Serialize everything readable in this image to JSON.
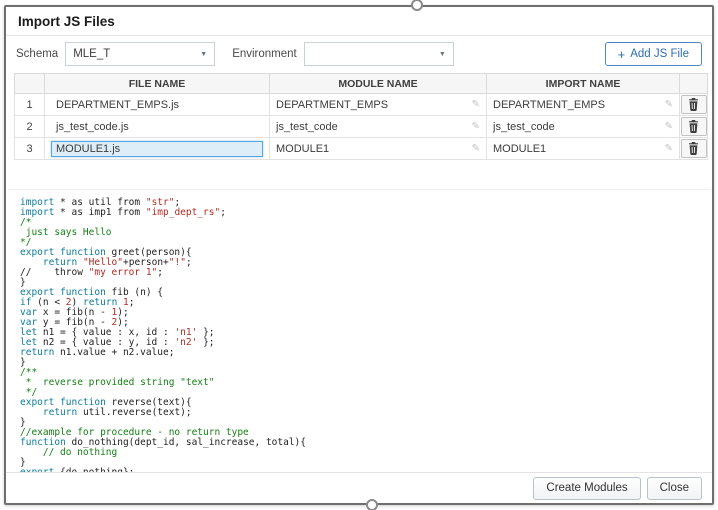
{
  "dialog": {
    "title": "Import JS Files"
  },
  "icons": {
    "caret": "▼",
    "pencil": "✎",
    "plus": "+",
    "trash": "trash-icon"
  },
  "colors": {
    "accent_blue": "#2d6db3",
    "selection_bg": "#ddeef9",
    "selection_border": "#58a6dd"
  },
  "toolbar": {
    "schema_label": "Schema",
    "schema_value": "MLE_T",
    "environment_label": "Environment",
    "environment_value": "",
    "add_button_label": "Add JS File"
  },
  "grid": {
    "headers": [
      "FILE NAME",
      "MODULE NAME",
      "IMPORT NAME"
    ],
    "rows": [
      {
        "num": "1",
        "file": "DEPARTMENT_EMPS.js",
        "module": "DEPARTMENT_EMPS",
        "import_name": "DEPARTMENT_EMPS",
        "selected": false
      },
      {
        "num": "2",
        "file": "js_test_code.js",
        "module": "js_test_code",
        "import_name": "js_test_code",
        "selected": false
      },
      {
        "num": "3",
        "file": "MODULE1.js",
        "module": "MODULE1",
        "import_name": "MODULE1",
        "selected": true
      }
    ]
  },
  "editor": {
    "colors": {
      "k": "#0f7b9c",
      "p": "#1f1f1f",
      "s": "#b22a22",
      "c": "#158015",
      "n": "#b22a22"
    },
    "lines": [
      [
        [
          "k",
          "import"
        ],
        [
          "p",
          " * as util from "
        ],
        [
          "s",
          "\"str\""
        ],
        [
          "p",
          ";"
        ]
      ],
      [
        [
          "k",
          "import"
        ],
        [
          "p",
          " * as imp1 from "
        ],
        [
          "s",
          "\"imp_dept_rs\""
        ],
        [
          "p",
          ";"
        ]
      ],
      [
        [
          "c",
          "/*"
        ]
      ],
      [
        [
          "c",
          " just says Hello"
        ]
      ],
      [
        [
          "c",
          "*/"
        ]
      ],
      [
        [
          "k",
          "export function"
        ],
        [
          "p",
          " greet(person){"
        ]
      ],
      [
        [
          "p",
          "    "
        ],
        [
          "k",
          "return"
        ],
        [
          "p",
          " "
        ],
        [
          "s",
          "\"Hello\""
        ],
        [
          "p",
          "+person+"
        ],
        [
          "s",
          "\"!\""
        ],
        [
          "p",
          ";"
        ]
      ],
      [
        [
          "p",
          "//    throw "
        ],
        [
          "s",
          "\"my error 1\""
        ],
        [
          "p",
          ";"
        ]
      ],
      [
        [
          "p",
          "}"
        ]
      ],
      [
        [
          "k",
          "export function"
        ],
        [
          "p",
          " fib (n) {"
        ]
      ],
      [
        [
          "k",
          "if"
        ],
        [
          "p",
          " (n < "
        ],
        [
          "n",
          "2"
        ],
        [
          "p",
          ") "
        ],
        [
          "k",
          "return"
        ],
        [
          "p",
          " "
        ],
        [
          "n",
          "1"
        ],
        [
          "p",
          ";"
        ]
      ],
      [
        [
          "k",
          "var"
        ],
        [
          "p",
          " x = fib(n - "
        ],
        [
          "n",
          "1"
        ],
        [
          "p",
          ");"
        ]
      ],
      [
        [
          "k",
          "var"
        ],
        [
          "p",
          " y = fib(n - "
        ],
        [
          "n",
          "2"
        ],
        [
          "p",
          ");"
        ]
      ],
      [
        [
          "k",
          "let"
        ],
        [
          "p",
          " n1 = { value : x, id : "
        ],
        [
          "s",
          "'n1'"
        ],
        [
          "p",
          " };"
        ]
      ],
      [
        [
          "k",
          "let"
        ],
        [
          "p",
          " n2 = { value : y, id : "
        ],
        [
          "s",
          "'n2'"
        ],
        [
          "p",
          " };"
        ]
      ],
      [
        [
          "k",
          "return"
        ],
        [
          "p",
          " n1.value + n2.value;"
        ]
      ],
      [
        [
          "p",
          "}"
        ]
      ],
      [
        [
          "c",
          "/**"
        ]
      ],
      [
        [
          "c",
          " *  reverse provided string \"text\""
        ]
      ],
      [
        [
          "c",
          " */"
        ]
      ],
      [
        [
          "k",
          "export function"
        ],
        [
          "p",
          " reverse(text){"
        ]
      ],
      [
        [
          "p",
          "    "
        ],
        [
          "k",
          "return"
        ],
        [
          "p",
          " util.reverse(text);"
        ]
      ],
      [
        [
          "p",
          "}"
        ]
      ],
      [
        [
          "c",
          "//example for procedure - no return type"
        ]
      ],
      [
        [
          "k",
          "function"
        ],
        [
          "p",
          " do_nothing(dept_id, sal_increase, total){"
        ]
      ],
      [
        [
          "c",
          "    // do nothing"
        ]
      ],
      [
        [
          "p",
          "}"
        ]
      ],
      [
        [
          "k",
          "export"
        ],
        [
          "p",
          " {do_nothing};"
        ]
      ]
    ]
  },
  "footer": {
    "create_label": "Create Modules",
    "close_label": "Close"
  }
}
